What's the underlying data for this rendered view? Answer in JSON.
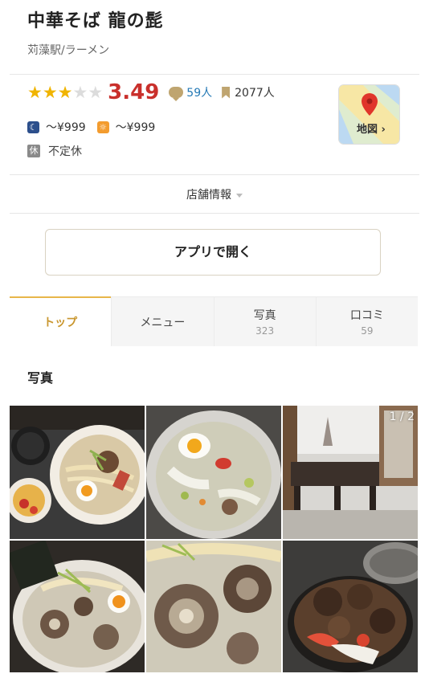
{
  "shop": {
    "name": "中華そば 龍の髭",
    "station_genre": "苅藻駅/ラーメン",
    "rating": "3.49",
    "reviews": "59人",
    "bookmarks": "2077人",
    "dinner_price": "～¥999",
    "lunch_price": "～¥999",
    "holiday_badge": "休",
    "holiday_text": "不定休",
    "map_label": "地図 ›",
    "night_icon_glyph": "☾",
    "day_icon_glyph": "☼"
  },
  "store_info_label": "店舗情報",
  "open_app_label": "アプリで開く",
  "tabs": [
    {
      "label": "トップ",
      "count": ""
    },
    {
      "label": "メニュー",
      "count": ""
    },
    {
      "label": "写真",
      "count": "323"
    },
    {
      "label": "口コミ",
      "count": "59"
    }
  ],
  "photos_section_title": "写真",
  "photo_counter": "1 / 2",
  "colors": {
    "accent_gold": "#e8b64a",
    "score_red": "#c9302c",
    "link_blue": "#2479b5",
    "star_gold": "#f0b400"
  },
  "photos": [
    {
      "name": "ramen-set-photo"
    },
    {
      "name": "clear-soup-ramen-photo"
    },
    {
      "name": "shop-interior-photo"
    },
    {
      "name": "oxtail-ramen-photo"
    },
    {
      "name": "oxtail-closeup-photo"
    },
    {
      "name": "oxtail-rice-bowl-photo"
    }
  ]
}
